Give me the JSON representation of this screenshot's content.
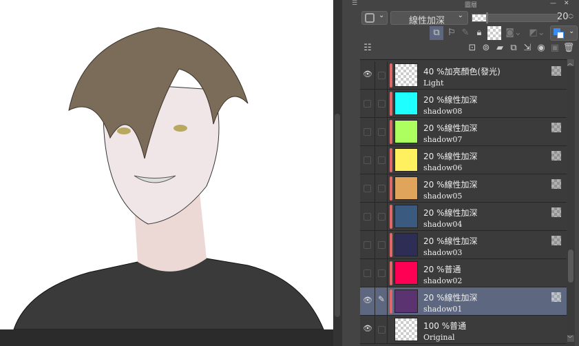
{
  "panel": {
    "title": "圖層",
    "blend_mode": "線性加深",
    "opacity": "20"
  },
  "layers": [
    {
      "mode": "40 %加亮顏色(發光)",
      "name": "Light",
      "color": "checker",
      "visible": true,
      "locked": true
    },
    {
      "mode": "20 %線性加深",
      "name": "shadow08",
      "color": "#1effff",
      "visible": false,
      "locked": false
    },
    {
      "mode": "20 %線性加深",
      "name": "shadow07",
      "color": "#adff5f",
      "visible": false,
      "locked": true
    },
    {
      "mode": "20 %線性加深",
      "name": "shadow06",
      "color": "#fff060",
      "visible": false,
      "locked": true
    },
    {
      "mode": "20 %線性加深",
      "name": "shadow05",
      "color": "#e0a55a",
      "visible": false,
      "locked": true
    },
    {
      "mode": "20 %線性加深",
      "name": "shadow04",
      "color": "#3b5a80",
      "visible": false,
      "locked": true
    },
    {
      "mode": "20 %線性加深",
      "name": "shadow03",
      "color": "#2d2d55",
      "visible": false,
      "locked": true
    },
    {
      "mode": "20 %普通",
      "name": "shadow02",
      "color": "#ff0055",
      "visible": false,
      "locked": false
    },
    {
      "mode": "20 %線性加深",
      "name": "shadow01",
      "color": "#5a3370",
      "visible": true,
      "locked": true,
      "selected": true
    },
    {
      "mode": "100 %普通",
      "name": "Original",
      "color": "checker",
      "visible": true,
      "locked": false
    }
  ]
}
